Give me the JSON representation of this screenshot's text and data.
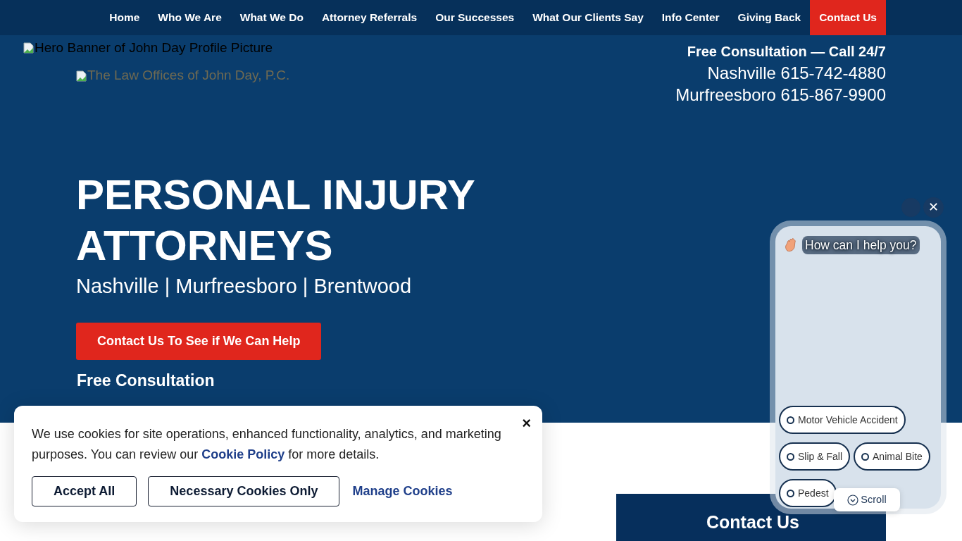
{
  "nav": {
    "items": [
      {
        "label": "Home",
        "kind": "link"
      },
      {
        "label": "Who We Are",
        "kind": "link"
      },
      {
        "label": "What We Do",
        "kind": "link"
      },
      {
        "label": "Attorney Referrals",
        "kind": "link"
      },
      {
        "label": "Our Successes",
        "kind": "link"
      },
      {
        "label": "What Our Clients Say",
        "kind": "link"
      },
      {
        "label": "Info Center",
        "kind": "link"
      },
      {
        "label": "Giving Back",
        "kind": "link"
      },
      {
        "label": "Contact Us",
        "kind": "cta"
      }
    ]
  },
  "header": {
    "banner_alt": "Hero Banner of John Day Profile Picture",
    "logo_alt": "The Law Offices of John Day, P.C.",
    "consult_line": "Free Consultation — Call 24/7",
    "phones": [
      "Nashville 615-742-4880",
      "Murfreesboro 615-867-9900"
    ]
  },
  "hero": {
    "title": "PERSONAL INJURY ATTORNEYS",
    "subtitle": "Nashville | Murfreesboro | Brentwood",
    "button": "Contact Us To See if We Can Help",
    "note": "Free Consultation"
  },
  "contact_box": {
    "title": "Contact Us"
  },
  "cookie_banner": {
    "text_before_link": "We use cookies for site operations, enhanced functionality, analytics, and marketing purposes. You can review our",
    "link": "Cookie Policy",
    "text_after_link": "for more details.",
    "close": "×",
    "buttons": [
      {
        "label": "Accept All",
        "kind": "outline"
      },
      {
        "label": "Necessary Cookies Only",
        "kind": "outline"
      },
      {
        "label": "Manage Cookies",
        "kind": "link"
      }
    ]
  },
  "chat": {
    "close": "✕",
    "greeting": "How can I help you?",
    "options": [
      "Motor Vehicle Accident",
      "Slip & Fall",
      "Animal Bite",
      "Pedest"
    ],
    "scroll": "Scroll"
  }
}
